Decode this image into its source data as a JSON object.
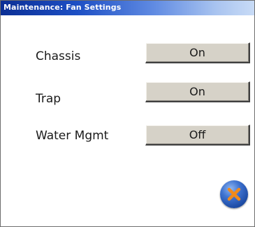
{
  "window": {
    "title": "Maintenance: Fan Settings"
  },
  "rows": [
    {
      "label": "Chassis",
      "value": "On"
    },
    {
      "label": "Trap",
      "value": "On"
    },
    {
      "label": "Water Mgmt",
      "value": "Off"
    }
  ],
  "close_button": {
    "icon": "close-x-icon",
    "icon_color": "#f08a1c"
  },
  "colors": {
    "title_bar_start": "#0b2f95",
    "title_bar_end": "#c8dbf6",
    "button_face": "#d6d2c8"
  }
}
